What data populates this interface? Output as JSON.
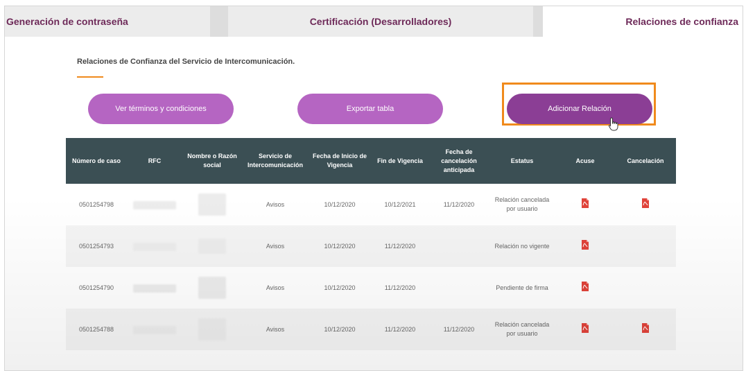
{
  "tabs": [
    {
      "label": "Generación de contraseña"
    },
    {
      "label": "Certificación (Desarrolladores)"
    },
    {
      "label": "Relaciones de confianza"
    }
  ],
  "section": {
    "heading": "Relaciones de Confianza del Servicio de Intercomunicación."
  },
  "buttons": {
    "terms": "Ver términos y condiciones",
    "export": "Exportar tabla",
    "add": "Adicionar Relación"
  },
  "colors": {
    "tab_text": "#6e2a59",
    "button_light": "#b565c2",
    "button_dark": "#8b3e95",
    "highlight": "#f08a1c",
    "table_header": "#3b4f54",
    "pdf_icon": "#e0433a"
  },
  "table": {
    "headers": [
      "Número de caso",
      "RFC",
      "Nombre o Razón social",
      "Servicio de Intercomunicación",
      "Fecha de Inicio de Vigencia",
      "Fin de Vigencia",
      "Fecha de cancelación anticipada",
      "Estatus",
      "Acuse",
      "Cancelación"
    ],
    "rows": [
      {
        "caso": "0501254798",
        "servicio": "Avisos",
        "inicio": "10/12/2020",
        "fin": "10/12/2021",
        "cancelacion": "11/12/2020",
        "estatus": "Relación cancelada por usuario",
        "acuse_icon": "pdf-icon",
        "cancel_icon": "pdf-icon"
      },
      {
        "caso": "0501254793",
        "servicio": "Avisos",
        "inicio": "10/12/2020",
        "fin": "11/12/2020",
        "cancelacion": "",
        "estatus": "Relación no vigente",
        "acuse_icon": "pdf-icon",
        "cancel_icon": ""
      },
      {
        "caso": "0501254790",
        "servicio": "Avisos",
        "inicio": "10/12/2020",
        "fin": "11/12/2020",
        "cancelacion": "",
        "estatus": "Pendiente de firma",
        "acuse_icon": "pdf-icon",
        "cancel_icon": ""
      },
      {
        "caso": "0501254788",
        "servicio": "Avisos",
        "inicio": "10/12/2020",
        "fin": "11/12/2020",
        "cancelacion": "11/12/2020",
        "estatus": "Relación cancelada por usuario",
        "acuse_icon": "pdf-icon",
        "cancel_icon": "pdf-icon"
      }
    ]
  }
}
